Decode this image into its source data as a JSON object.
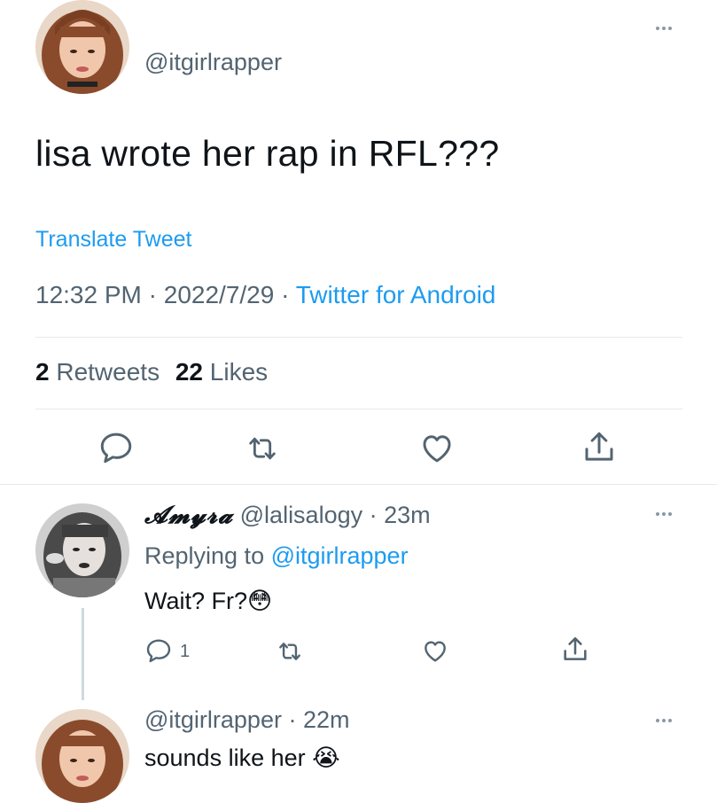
{
  "main_tweet": {
    "handle": "@itgirlrapper",
    "text": "lisa wrote her rap in RFL???",
    "translate_label": "Translate Tweet",
    "time": "12:32 PM",
    "sep1": "·",
    "date": "2022/7/29",
    "sep2": "·",
    "source": "Twitter for Android",
    "retweets_count": "2",
    "retweets_label": "Retweets",
    "likes_count": "22",
    "likes_label": "Likes",
    "icons": [
      "reply-icon",
      "retweet-icon",
      "like-icon",
      "share-icon"
    ]
  },
  "reply1": {
    "display_name": "𝓐𝓶𝔂𝓻𝓪",
    "handle": "@lalisalogy",
    "sep": "·",
    "age": "23m",
    "replying_prefix": "Replying to",
    "replying_handle": "@itgirlrapper",
    "text": "Wait? Fr?",
    "emoji": "😳",
    "reply_count": "1"
  },
  "reply2": {
    "handle": "@itgirlrapper",
    "sep": "·",
    "age": "22m",
    "text": "sounds like her",
    "emoji": "😭"
  },
  "colors": {
    "link": "#1d9bf0",
    "muted": "#536471",
    "text": "#0f1419"
  }
}
